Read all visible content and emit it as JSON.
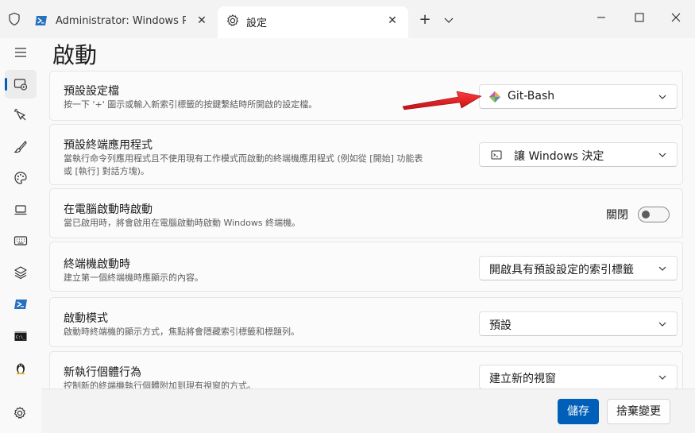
{
  "tabs": [
    {
      "label": "Administrator: Windows PowerShell",
      "icon": "powershell-icon"
    },
    {
      "label": "設定",
      "icon": "gear-icon"
    }
  ],
  "page": {
    "title": "啟動"
  },
  "settings": {
    "default_profile": {
      "title": "預設設定檔",
      "desc": "按一下 '+' 圖示或輸入新索引標籤的按鍵繫結時所開啟的設定檔。",
      "value": "Git-Bash",
      "icon": "git-icon"
    },
    "default_terminal": {
      "title": "預設終端應用程式",
      "desc_line1": "當執行命令列應用程式且不使用現有工作模式而啟動的終端機應用程式 (例如從 [開始] 功能表",
      "desc_line2": "或 [執行] 對話方塊)。",
      "value": "讓 Windows 決定",
      "icon": "terminal-icon"
    },
    "launch_on_startup": {
      "title": "在電腦啟動時啟動",
      "desc": "當已啟用時，將會啟用在電腦啟動時啟動 Windows 終端機。",
      "toggle_label": "關閉",
      "toggle_on": false
    },
    "when_terminal_starts": {
      "title": "終端機啟動時",
      "desc": "建立第一個終端機時應顯示的內容。",
      "value": "開啟具有預設設定的索引標籤"
    },
    "launch_mode": {
      "title": "啟動模式",
      "desc": "啟動時終端機的顯示方式，焦點將會隱藏索引標籤和標題列。",
      "value": "預設"
    },
    "new_instance": {
      "title": "新執行個體行為",
      "desc": "控制新的終端機執行個體附加到現有視窗的方式。",
      "value": "建立新的視窗"
    }
  },
  "footer": {
    "save_label": "儲存",
    "discard_label": "捨棄變更"
  },
  "colors": {
    "accent": "#005fb8",
    "annotation_arrow": "#e0161b"
  }
}
